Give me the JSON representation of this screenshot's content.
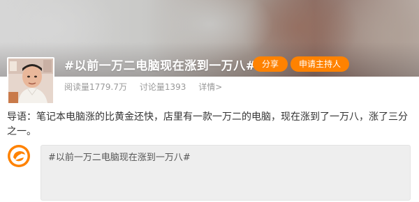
{
  "topic": {
    "title": "#以前一万二电脑现在涨到一万八#",
    "share_label": "分享",
    "apply_host_label": "申请主持人"
  },
  "stats": {
    "reads": "阅读量1779.7万",
    "discussions": "讨论量1393",
    "details_label": "详情>"
  },
  "intro": {
    "text": "导语：笔记本电脑涨的比黄金还快，店里有一款一万二的电脑，现在涨到了一万八，涨了三分之一。"
  },
  "composer": {
    "value": "#以前一万二电脑现在涨到一万八#"
  },
  "colors": {
    "accent": "#ff8200",
    "muted_text": "#999999",
    "body_text": "#333333",
    "composer_bg": "#eeeeee"
  },
  "icons": {
    "user_logo": "weibo-logo-icon"
  }
}
